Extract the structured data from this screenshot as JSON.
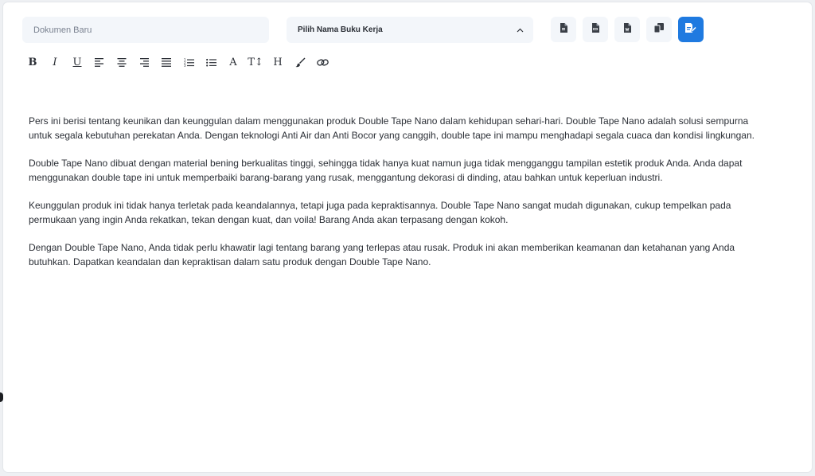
{
  "header": {
    "document_name_placeholder": "Dokumen Baru",
    "workbook_select_label": "Pilih Nama Buku Kerja"
  },
  "actions": [
    {
      "icon": "file-icon"
    },
    {
      "icon": "pdf-file-icon"
    },
    {
      "icon": "doc-file-icon"
    },
    {
      "icon": "copy-icon"
    },
    {
      "icon": "save-edit-icon",
      "primary": true
    }
  ],
  "toolbar": [
    {
      "id": "bold",
      "glyph": "B"
    },
    {
      "id": "italic",
      "glyph": "I"
    },
    {
      "id": "underline",
      "glyph": "U"
    },
    {
      "id": "align-left",
      "glyph": ""
    },
    {
      "id": "align-center",
      "glyph": ""
    },
    {
      "id": "align-right",
      "glyph": ""
    },
    {
      "id": "align-justify",
      "glyph": ""
    },
    {
      "id": "ordered-list",
      "glyph": ""
    },
    {
      "id": "bullet-list",
      "glyph": ""
    },
    {
      "id": "font-color",
      "glyph": "A"
    },
    {
      "id": "font-size",
      "glyph": "T↕"
    },
    {
      "id": "heading",
      "glyph": "H"
    },
    {
      "id": "brush",
      "glyph": ""
    },
    {
      "id": "link",
      "glyph": ""
    }
  ],
  "editor": {
    "paragraphs": [
      "Pers ini berisi tentang keunikan dan keunggulan dalam menggunakan produk Double Tape Nano dalam kehidupan sehari-hari. Double Tape Nano adalah solusi sempurna untuk segala kebutuhan perekatan Anda. Dengan teknologi Anti Air dan Anti Bocor yang canggih, double tape ini mampu menghadapi segala cuaca dan kondisi lingkungan.",
      "Double Tape Nano dibuat dengan material bening berkualitas tinggi, sehingga tidak hanya kuat namun juga tidak mengganggu tampilan estetik produk Anda. Anda dapat menggunakan double tape ini untuk memperbaiki barang-barang yang rusak, menggantung dekorasi di dinding, atau bahkan untuk keperluan industri.",
      "Keunggulan produk ini tidak hanya terletak pada keandalannya, tetapi juga pada kepraktisannya. Double Tape Nano sangat mudah digunakan, cukup tempelkan pada permukaan yang ingin Anda rekatkan, tekan dengan kuat, dan voila! Barang Anda akan terpasang dengan kokoh.",
      "Dengan Double Tape Nano, Anda tidak perlu khawatir lagi tentang barang yang terlepas atau rusak. Produk ini akan memberikan keamanan dan ketahanan yang Anda butuhkan. Dapatkan keandalan dan kepraktisan dalam satu produk dengan Double Tape Nano."
    ]
  },
  "colors": {
    "accent": "#1f7ae0",
    "field_bg": "#f3f6fa"
  }
}
